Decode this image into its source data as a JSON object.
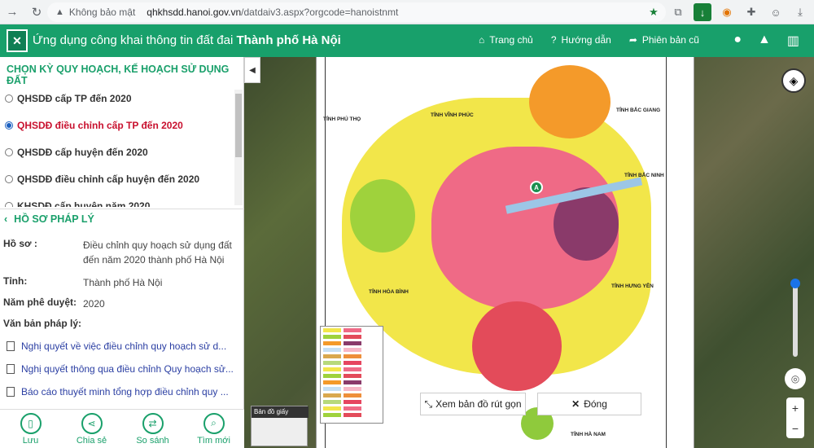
{
  "browser": {
    "insecure_label": "Không bảo mật",
    "url_host": "qhkhsdd.hanoi.gov.vn",
    "url_path": "/datdaiv3.aspx?orgcode=hanoistnmt"
  },
  "header": {
    "title_prefix": "Ứng dụng công khai thông tin đất đai ",
    "title_bold": "Thành phố Hà Nội",
    "nav": [
      "Trang chủ",
      "Hướng dẫn",
      "Phiên bản cũ"
    ]
  },
  "panel": {
    "heading": "CHỌN KỲ QUY HOẠCH, KẾ HOẠCH SỬ DỤNG ĐẤT",
    "options": [
      {
        "label": "QHSDĐ cấp TP đến 2020",
        "selected": false
      },
      {
        "label": "QHSDĐ điều chỉnh cấp TP đến 2020",
        "selected": true
      },
      {
        "label": "QHSDĐ cấp huyện đến 2020",
        "selected": false
      },
      {
        "label": "QHSDĐ điều chỉnh cấp huyện đến 2020",
        "selected": false
      },
      {
        "label": "KHSDĐ cấp huyện năm 2020",
        "selected": false
      }
    ],
    "legal_title": "HỒ SƠ PHÁP LÝ",
    "fields": {
      "hoso_k": "Hồ sơ :",
      "hoso_v": "Điều chỉnh quy hoạch sử dụng đất đến năm 2020 thành phố Hà Nội",
      "tinh_k": "Tỉnh:",
      "tinh_v": "Thành phố Hà Nội",
      "nam_k": "Năm phê duyệt:",
      "nam_v": "2020"
    },
    "docs_label": "Văn bản pháp lý:",
    "docs": [
      "Nghị quyết về việc điều chỉnh quy hoạch sử d...",
      "Nghị quyết thông qua điều chỉnh Quy hoạch sử...",
      "Báo cáo thuyết minh tổng hợp điều chỉnh quy ..."
    ],
    "footer": [
      "Lưu",
      "Chia sẻ",
      "So sánh",
      "Tìm mới"
    ]
  },
  "map": {
    "labels": [
      "TỈNH PHÚ THỌ",
      "TỈNH VĨNH PHÚC",
      "TỈNH BẮC GIANG",
      "TỈNH BẮC NINH",
      "TỈNH HƯNG YÊN",
      "TỈNH HÒA BÌNH",
      "TỈNH HÀ NAM"
    ],
    "basemap_label": "Bản đồ giấy",
    "btn_simplify": "Xem bản đồ rút gọn",
    "btn_close": "Đóng",
    "marker": "A"
  },
  "colors": {
    "brand": "#18a06b",
    "accent": "#c8102e"
  }
}
